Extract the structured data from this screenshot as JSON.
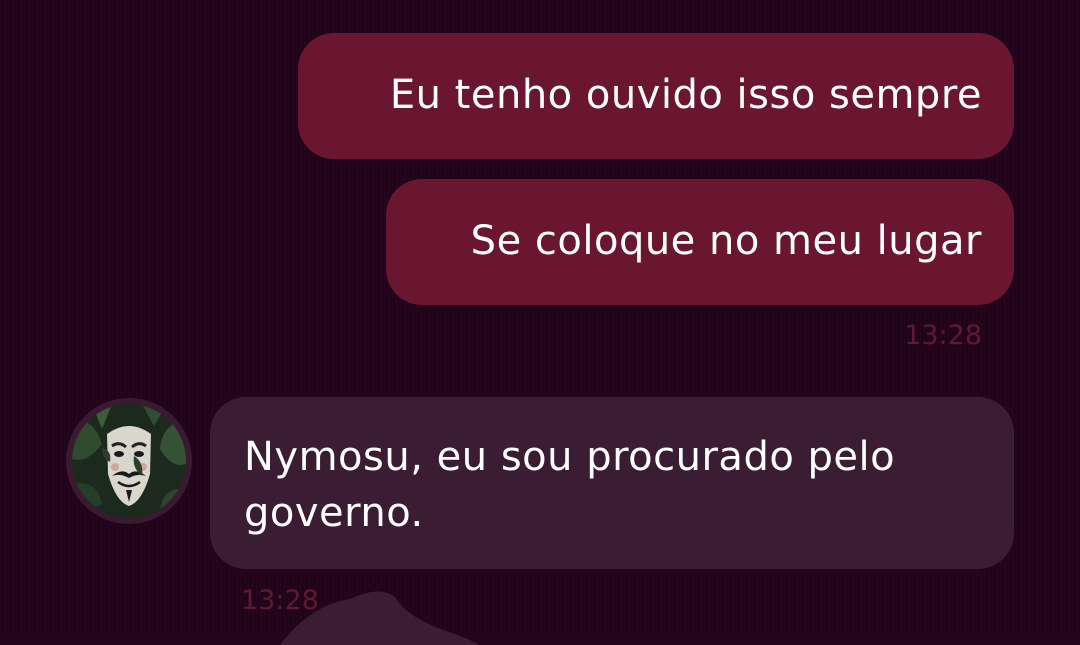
{
  "messages": {
    "outgoing": [
      {
        "text": "Eu tenho ouvido isso sempre"
      },
      {
        "text": "Se coloque no meu lugar"
      }
    ],
    "outgoing_time": "13:28",
    "incoming": [
      {
        "text": "Nymosu, eu sou procurado pelo governo."
      }
    ],
    "incoming_time": "13:28"
  },
  "avatar": {
    "icon": "guy-fawkes-mask-avatar"
  },
  "colors": {
    "background": "#22041a",
    "outgoing_bubble": "#6b1630",
    "incoming_bubble": "#3b1d33",
    "timestamp": "#5d1a30",
    "text": "#ffffff"
  }
}
